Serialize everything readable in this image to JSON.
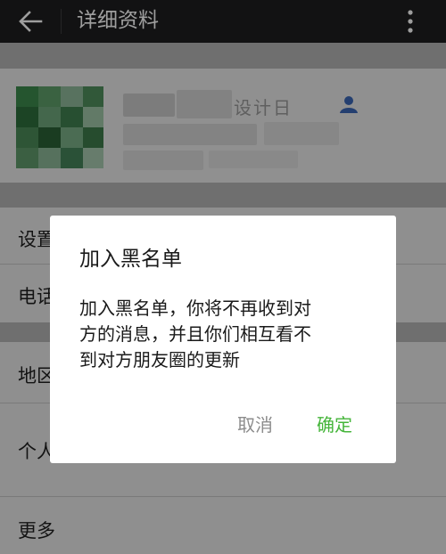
{
  "header": {
    "title": "详细资料",
    "back_icon": "arrow-left-icon",
    "more_icon": "more-vertical-icon",
    "background": "#1e1e20"
  },
  "profile": {
    "avatar": "pixelated-avatar",
    "name_fragment": "设计日",
    "contact_icon": "person-icon",
    "accent": "#3a66b5"
  },
  "rows": [
    {
      "label": "设置"
    },
    {
      "label": "电话"
    },
    {
      "label": "地区"
    },
    {
      "label": "个人"
    },
    {
      "label": "更多"
    }
  ],
  "dialog": {
    "title": "加入黑名单",
    "message_lines": [
      "加入黑名单，你将不再收到对",
      "方的消息，并且你们相互看不",
      "到对方朋友圈的更新"
    ],
    "cancel_label": "取消",
    "confirm_label": "确定",
    "confirm_color": "#45b53a",
    "cancel_color": "#8c8c8c"
  }
}
